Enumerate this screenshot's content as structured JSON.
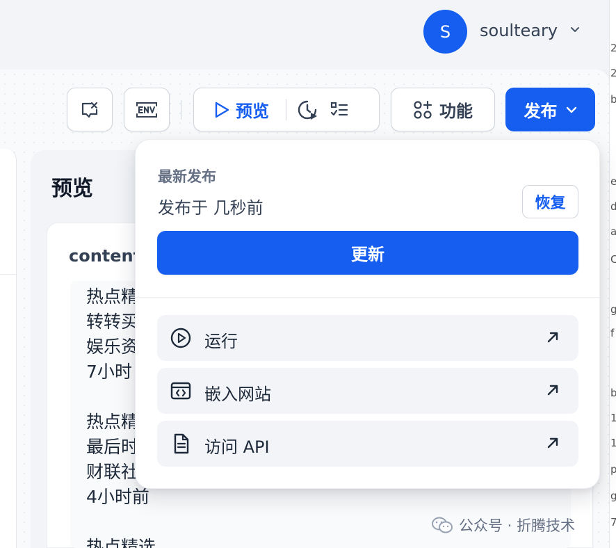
{
  "user": {
    "initial": "S",
    "name": "soulteary"
  },
  "toolbar": {
    "preview_label": "预览",
    "features_label": "功能",
    "publish_label": "发布"
  },
  "publish_menu": {
    "heading": "最新发布",
    "time_text": "发布于 几秒前",
    "restore_label": "恢复",
    "update_label": "更新",
    "actions": [
      {
        "label": "运行",
        "icon": "play-circle-icon"
      },
      {
        "label": "嵌入网站",
        "icon": "embed-icon"
      },
      {
        "label": "访问 API",
        "icon": "document-icon"
      }
    ]
  },
  "preview_panel": {
    "title": "预览",
    "content_label": "content",
    "lines": [
      "热点精",
      "转转买",
      "娱乐资",
      "7小时",
      "热点精",
      "最后时",
      "财联社",
      "4小时前",
      "热点精选"
    ]
  },
  "right_edge_chars": [
    "2",
    "2",
    "b",
    "e",
    "d",
    "a",
    "C",
    "g",
    "f",
    "b",
    "1",
    "1",
    "p",
    "g",
    "7"
  ],
  "watermark": {
    "text": "公众号 · 折腾技术"
  },
  "colors": {
    "accent": "#155eef"
  }
}
